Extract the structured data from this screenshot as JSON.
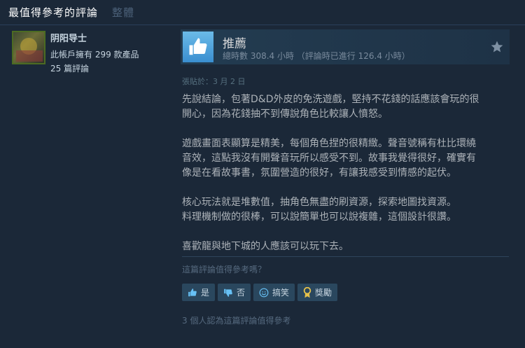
{
  "tabs": [
    {
      "label": "最值得參考的評論"
    },
    {
      "label": "整體"
    }
  ],
  "user": {
    "name": "阴阳导士",
    "owned": "此帳戶擁有 299 款產品",
    "reviews": "25 篇評論"
  },
  "review": {
    "verdict": "推薦",
    "hours": "總時數 308.4 小時 （評論時已進行 126.4 小時）",
    "posted": "張貼於：3 月 2 日",
    "body": "先說結論，包著D&D外皮的免洗遊戲，堅持不花錢的話應該會玩的很\n開心，因為花錢抽不到傳說角色比較讓人憤怒。\n\n遊戲畫面表顯算是精美，每個角色捏的很精緻。聲音號稱有杜比環繞\n音效，這點我沒有開聲音玩所以感受不到。故事我覺得很好，確實有\n像是在看故事書，氛圍營造的很好，有讓我感受到情感的起伏。\n\n核心玩法就是堆數值，抽角色無盡的刷資源，探索地圖找資源。\n料理機制做的很棒，可以說簡單也可以說複雜，這個設計很讚。\n\n喜歡龍與地下城的人應該可以玩下去。"
  },
  "helpful": {
    "question": "這篇評論值得參考嗎？",
    "yes": "是",
    "no": "否",
    "funny": "搞笑",
    "award": "獎勵",
    "count": "3 個人認為這篇評論值得參考"
  },
  "icons": {
    "thumb": "thumbs-up-icon",
    "star": "award-star-icon"
  },
  "colors": {
    "background": "#1b2838",
    "thumb": "#5ba9e0",
    "button": "#2a475e",
    "award_gold": "#e6c14a"
  }
}
